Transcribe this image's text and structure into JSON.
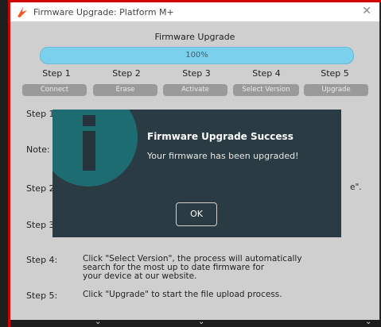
{
  "window": {
    "title": "Firmware Upgrade: Platform M+",
    "close_icon": "close-icon"
  },
  "heading": "Firmware Upgrade",
  "progress": {
    "value": 1.0,
    "label": "100%",
    "color": "#7bd0ee"
  },
  "steps": [
    {
      "label": "Step 1",
      "button": "Connect"
    },
    {
      "label": "Step 2",
      "button": "Erase"
    },
    {
      "label": "Step 3",
      "button": "Activate"
    },
    {
      "label": "Step 4",
      "button": "Select Version"
    },
    {
      "label": "Step 5",
      "button": "Upgrade"
    }
  ],
  "instructions": [
    {
      "label": "Step 1",
      "text": ""
    },
    {
      "label": "Note:",
      "text": ""
    },
    {
      "label": "Step 2",
      "text": "e\"."
    },
    {
      "label": "Step 3",
      "text": ""
    },
    {
      "label": "Step 4:",
      "lines": [
        "Click \"Select Version\", the process will automatically",
        "search for the most up to date firmware for",
        "your device at our website."
      ]
    },
    {
      "label": "Step 5:",
      "lines": [
        "Click \"Upgrade\" to start the file upload process."
      ]
    }
  ],
  "dialog": {
    "icon": "info-icon",
    "title": "Firmware Upgrade Success",
    "message": "Your firmware has been upgraded!",
    "ok": "OK"
  },
  "colors": {
    "accent": "#7bd0ee",
    "dialog_bg": "#2a3b43",
    "dialog_icon": "#1d6c72",
    "frame": "#d20000"
  }
}
